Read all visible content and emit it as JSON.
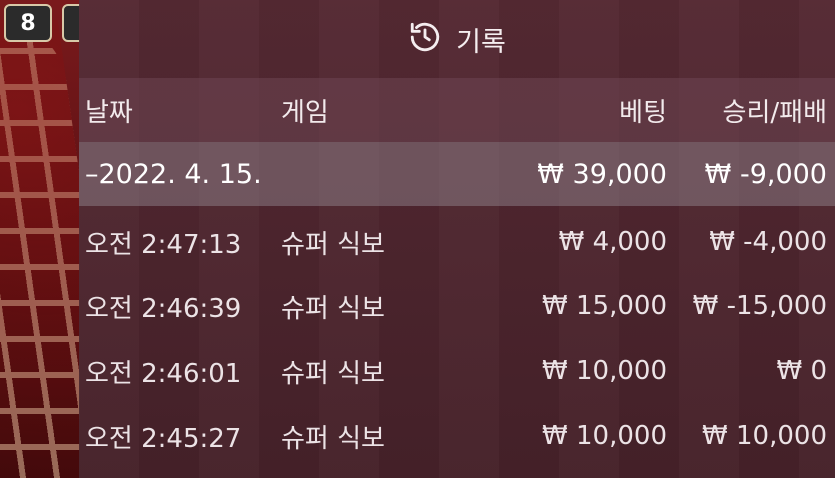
{
  "game_badge": "8",
  "header": {
    "title": "기록",
    "icon": "history-icon"
  },
  "columns": {
    "date": "날짜",
    "game": "게임",
    "bet": "베팅",
    "result": "승리/패배"
  },
  "date_group": {
    "date": "–2022. 4. 15.",
    "bet_total": "₩ 39,000",
    "result_total": "₩ -9,000"
  },
  "rows": [
    {
      "time": "오전 2:47:13",
      "game": "슈퍼 식보",
      "bet": "₩ 4,000",
      "result": "₩ -4,000"
    },
    {
      "time": "오전 2:46:39",
      "game": "슈퍼 식보",
      "bet": "₩ 15,000",
      "result": "₩ -15,000"
    },
    {
      "time": "오전 2:46:01",
      "game": "슈퍼 식보",
      "bet": "₩ 10,000",
      "result": "₩ 0"
    },
    {
      "time": "오전 2:45:27",
      "game": "슈퍼 식보",
      "bet": "₩ 10,000",
      "result": "₩ 10,000"
    }
  ]
}
